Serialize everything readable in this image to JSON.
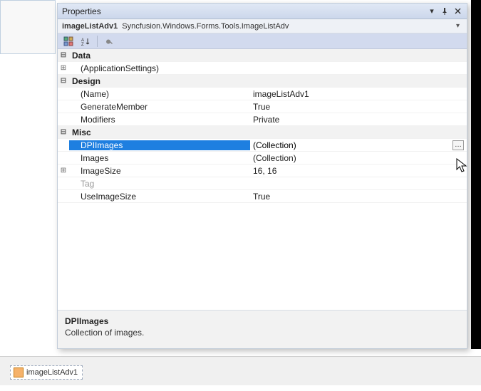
{
  "window": {
    "title": "Properties"
  },
  "object_selector": {
    "name": "imageListAdv1",
    "type": "Syncfusion.Windows.Forms.Tools.ImageListAdv"
  },
  "categories": {
    "data": {
      "label": "Data",
      "app_settings": "(ApplicationSettings)"
    },
    "design": {
      "label": "Design",
      "name_lbl": "(Name)",
      "name_val": "imageListAdv1",
      "genmem_lbl": "GenerateMember",
      "genmem_val": "True",
      "mod_lbl": "Modifiers",
      "mod_val": "Private"
    },
    "misc": {
      "label": "Misc",
      "dpi_lbl": "DPIImages",
      "dpi_val": "(Collection)",
      "images_lbl": "Images",
      "images_val": "(Collection)",
      "imgsize_lbl": "ImageSize",
      "imgsize_val": "16, 16",
      "tag_lbl": "Tag",
      "tag_val": "",
      "useimg_lbl": "UseImageSize",
      "useimg_val": "True"
    }
  },
  "description": {
    "title": "DPIImages",
    "text": "Collection of images."
  },
  "component_tray": {
    "item": "imageListAdv1"
  },
  "glyphs": {
    "expand": "⊞",
    "collapse": "⊟",
    "dots": "…"
  }
}
